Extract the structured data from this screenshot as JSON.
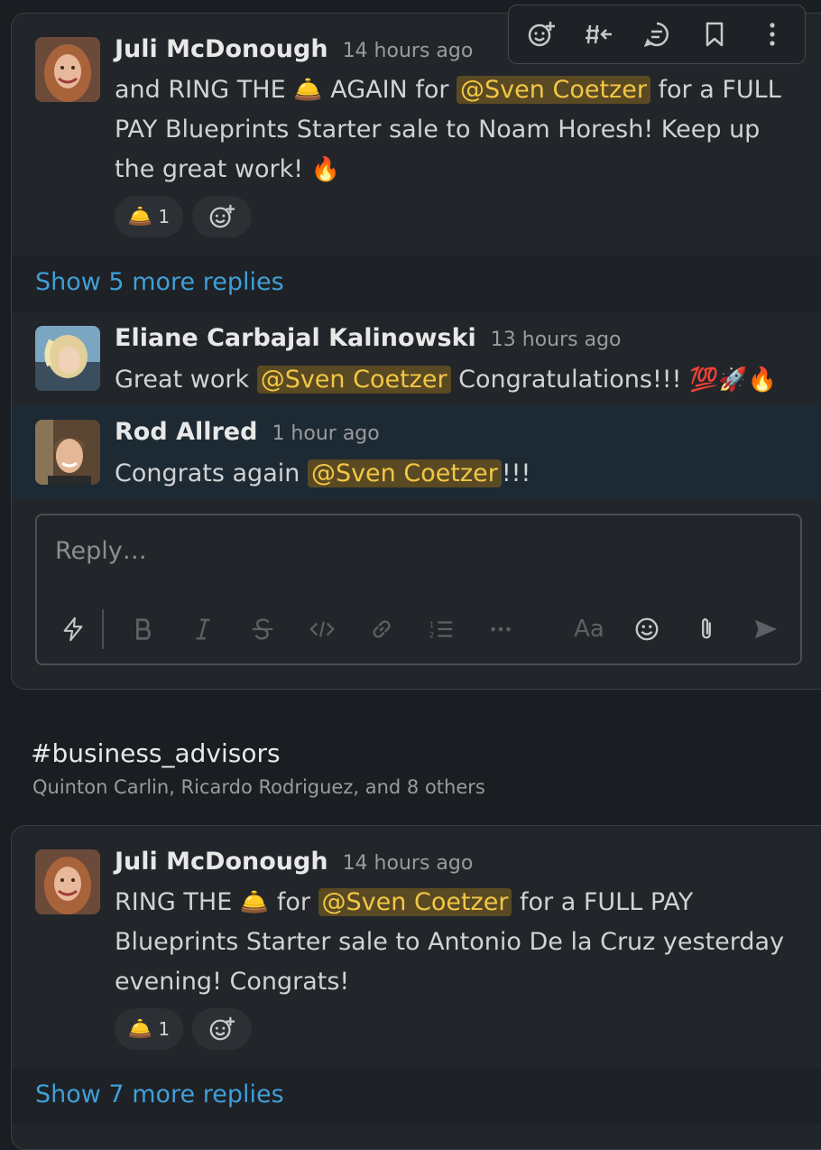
{
  "hover_toolbar": {
    "icons": [
      "add-reaction-icon",
      "reply-in-channel-icon",
      "reply-thread-icon",
      "bookmark-icon",
      "more-actions-icon"
    ]
  },
  "thread1": {
    "msg1": {
      "author": "Juli McDonough",
      "time": "14 hours ago",
      "text_a": "and RING THE ",
      "emoji_bell": "🛎️",
      "text_b": " AGAIN for ",
      "mention": "@Sven Coetzer",
      "text_c": " for a FULL PAY Blueprints Starter sale to Noam Horesh! Keep up the great work! ",
      "emoji_fire": "🔥",
      "reaction_emoji": "🛎️",
      "reaction_count": "1"
    },
    "show_more": "Show 5 more replies",
    "msg2": {
      "author": "Eliane Carbajal Kalinowski",
      "time": "13 hours ago",
      "text_a": "Great work ",
      "mention": "@Sven Coetzer",
      "text_b": " Congratulations!!! ",
      "emojis": "💯🚀🔥"
    },
    "msg3": {
      "author": "Rod Allred",
      "time": "1 hour ago",
      "text_a": "Congrats again ",
      "mention": "@Sven Coetzer",
      "text_b": "!!!"
    },
    "reply_placeholder": "Reply…",
    "composer_icons": [
      "shortcuts-icon",
      "bold-icon",
      "italic-icon",
      "strikethrough-icon",
      "code-icon",
      "link-icon",
      "ordered-list-icon",
      "more-formatting-icon",
      "text-format-icon",
      "emoji-icon",
      "attach-icon",
      "send-icon"
    ],
    "text_format_label": "Aa"
  },
  "channel": {
    "hash": "#",
    "name": "business_advisors",
    "members": "Quinton Carlin, Ricardo Rodriguez, and 8 others"
  },
  "thread2": {
    "msg1": {
      "author": "Juli McDonough",
      "time": "14 hours ago",
      "text_a": "RING THE ",
      "emoji_bell": "🛎️",
      "text_b": " for ",
      "mention": "@Sven Coetzer",
      "text_c": " for a FULL PAY Blueprints Starter sale to Antonio De la Cruz yesterday evening! Congrats!",
      "reaction_emoji": "🛎️",
      "reaction_count": "1"
    },
    "show_more": "Show 7 more replies"
  }
}
